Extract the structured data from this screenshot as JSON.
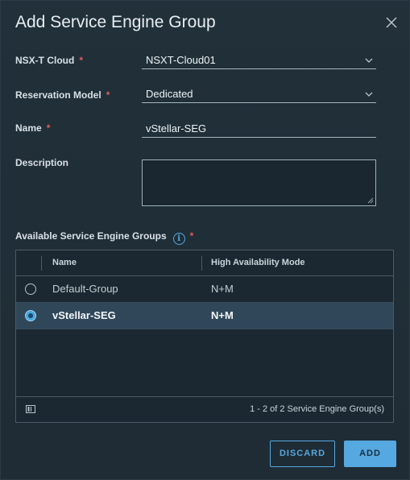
{
  "dialog": {
    "title": "Add Service Engine Group"
  },
  "form": {
    "cloud": {
      "label": "NSX-T Cloud",
      "value": "NSXT-Cloud01"
    },
    "reservation": {
      "label": "Reservation Model",
      "value": "Dedicated"
    },
    "name": {
      "label": "Name",
      "value": "vStellar-SEG"
    },
    "description": {
      "label": "Description",
      "value": ""
    },
    "required_mark": "*"
  },
  "groups": {
    "label": "Available Service Engine Groups",
    "info_glyph": "i",
    "columns": [
      "Name",
      "High Availability Mode"
    ],
    "rows": [
      {
        "name": "Default-Group",
        "mode": "N+M",
        "selected": false
      },
      {
        "name": "vStellar-SEG",
        "mode": "N+M",
        "selected": true
      }
    ],
    "footer_count": "1 - 2 of 2 Service Engine Group(s)"
  },
  "buttons": {
    "discard": "DISCARD",
    "add": "ADD"
  },
  "colors": {
    "accent": "#56a8e0",
    "required": "#e25b5b",
    "selected_row": "#30475a"
  }
}
